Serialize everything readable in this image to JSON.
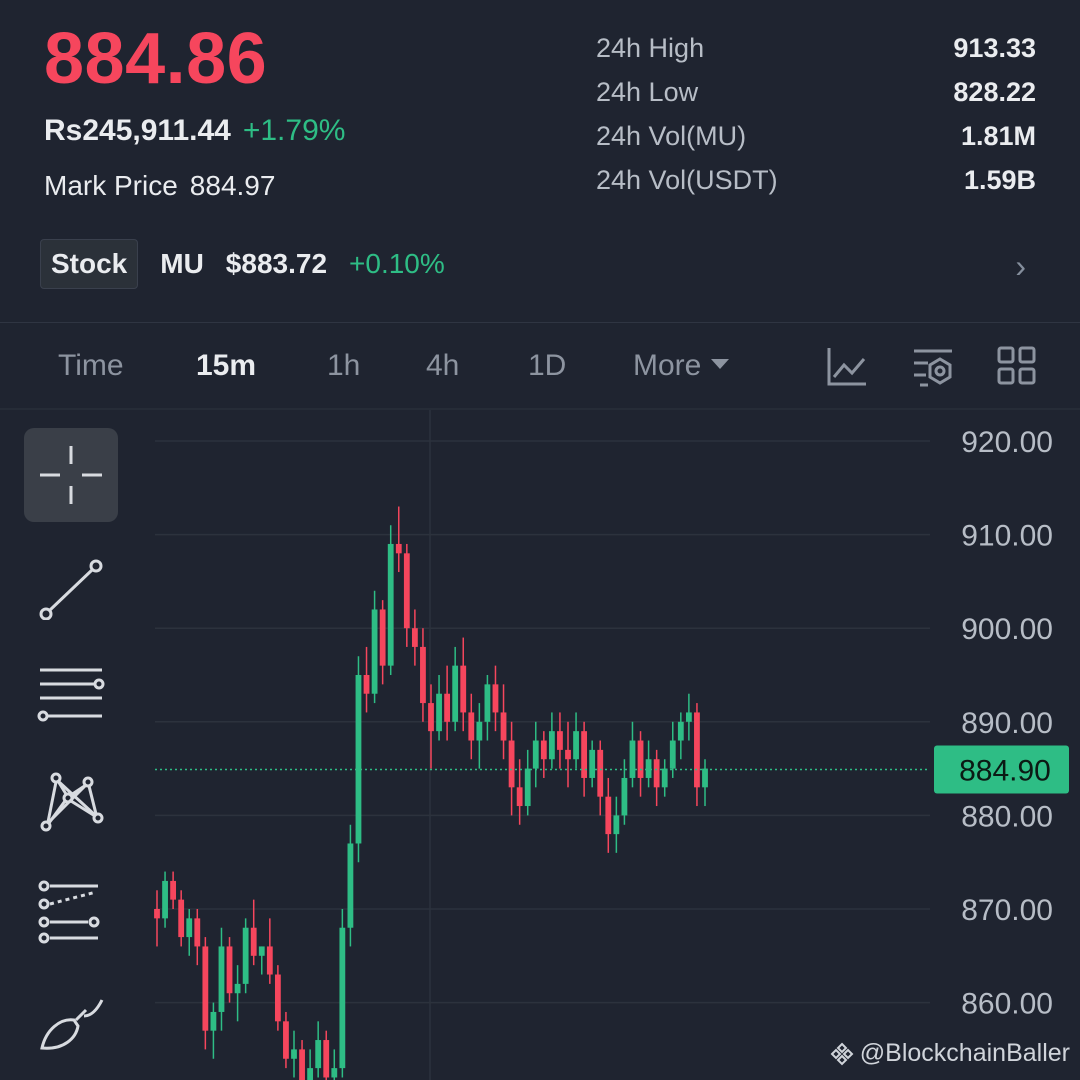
{
  "ticker": {
    "last_price": "884.86",
    "fiat_price": "Rs245,911.44",
    "change_percent": "+1.79%",
    "mark_price_label": "Mark Price",
    "mark_price": "884.97"
  },
  "stats": [
    {
      "label": "24h High",
      "value": "913.33"
    },
    {
      "label": "24h Low",
      "value": "828.22"
    },
    {
      "label": "24h Vol(MU)",
      "value": "1.81M"
    },
    {
      "label": "24h Vol(USDT)",
      "value": "1.59B"
    }
  ],
  "stock": {
    "badge": "Stock",
    "symbol": "MU",
    "price": "$883.72",
    "change": "+0.10%",
    "arrow": "›"
  },
  "timeframes": {
    "time": "Time",
    "m15": "15m",
    "h1": "1h",
    "h4": "4h",
    "d1": "1D",
    "more": "More",
    "active": "15m"
  },
  "toolbar_icons": [
    "indicator-icon",
    "settings-icon",
    "layout-grid-icon"
  ],
  "drawing_tools": [
    "crosshair-icon",
    "trend-line-icon",
    "horizontal-lines-icon",
    "pattern-icon",
    "fib-icon",
    "brush-icon"
  ],
  "colors": {
    "up": "#2ebd85",
    "down": "#f6465d",
    "bg": "#1f2430",
    "grid": "#2c323d",
    "axis_text": "#b7bdc6"
  },
  "watermark": "@BlockchainBaller",
  "chart_data": {
    "type": "candlestick",
    "x_unit": "15m",
    "y_ticks": [
      920,
      910,
      900,
      890,
      880,
      870,
      860
    ],
    "y_tick_labels": [
      "920.00",
      "910.00",
      "900.00",
      "890.00",
      "880.00",
      "870.00",
      "860.00"
    ],
    "ylim": [
      852,
      922
    ],
    "current_price": 884.9,
    "current_price_label": "884.90",
    "grid": true,
    "candles": [
      [
        870,
        872,
        866,
        869
      ],
      [
        869,
        874,
        868,
        873
      ],
      [
        873,
        874,
        870,
        871
      ],
      [
        871,
        872,
        866,
        867
      ],
      [
        867,
        870,
        865,
        869
      ],
      [
        869,
        870,
        864,
        866
      ],
      [
        866,
        867,
        855,
        857
      ],
      [
        857,
        860,
        854,
        859
      ],
      [
        859,
        868,
        857,
        866
      ],
      [
        866,
        867,
        860,
        861
      ],
      [
        861,
        864,
        858,
        862
      ],
      [
        862,
        869,
        861,
        868
      ],
      [
        868,
        871,
        864,
        865
      ],
      [
        865,
        866,
        863,
        866
      ],
      [
        866,
        869,
        862,
        863
      ],
      [
        863,
        864,
        857,
        858
      ],
      [
        858,
        859,
        853,
        854
      ],
      [
        854,
        857,
        852,
        855
      ],
      [
        855,
        856,
        850,
        851
      ],
      [
        851,
        855,
        849,
        853
      ],
      [
        853,
        858,
        852,
        856
      ],
      [
        856,
        857,
        850,
        852
      ],
      [
        852,
        855,
        849,
        853
      ],
      [
        853,
        870,
        852,
        868
      ],
      [
        868,
        879,
        866,
        877
      ],
      [
        877,
        897,
        875,
        895
      ],
      [
        895,
        898,
        891,
        893
      ],
      [
        893,
        904,
        892,
        902
      ],
      [
        902,
        903,
        894,
        896
      ],
      [
        896,
        911,
        895,
        909
      ],
      [
        909,
        913,
        906,
        908
      ],
      [
        908,
        909,
        898,
        900
      ],
      [
        900,
        902,
        896,
        898
      ],
      [
        898,
        900,
        890,
        892
      ],
      [
        892,
        894,
        885,
        889
      ],
      [
        889,
        895,
        888,
        893
      ],
      [
        893,
        896,
        888,
        890
      ],
      [
        890,
        898,
        889,
        896
      ],
      [
        896,
        899,
        889,
        891
      ],
      [
        891,
        893,
        886,
        888
      ],
      [
        888,
        892,
        885,
        890
      ],
      [
        890,
        895,
        888,
        894
      ],
      [
        894,
        896,
        889,
        891
      ],
      [
        891,
        894,
        886,
        888
      ],
      [
        888,
        890,
        880,
        883
      ],
      [
        883,
        886,
        879,
        881
      ],
      [
        881,
        887,
        880,
        885
      ],
      [
        885,
        890,
        883,
        888
      ],
      [
        888,
        889,
        884,
        886
      ],
      [
        886,
        891,
        885,
        889
      ],
      [
        889,
        891,
        885,
        887
      ],
      [
        887,
        890,
        883,
        886
      ],
      [
        886,
        891,
        885,
        889
      ],
      [
        889,
        890,
        882,
        884
      ],
      [
        884,
        888,
        883,
        887
      ],
      [
        887,
        888,
        880,
        882
      ],
      [
        882,
        884,
        876,
        878
      ],
      [
        878,
        882,
        876,
        880
      ],
      [
        880,
        886,
        879,
        884
      ],
      [
        884,
        890,
        883,
        888
      ],
      [
        888,
        889,
        882,
        884
      ],
      [
        884,
        888,
        883,
        886
      ],
      [
        886,
        887,
        881,
        883
      ],
      [
        883,
        886,
        882,
        885
      ],
      [
        885,
        890,
        884,
        888
      ],
      [
        888,
        891,
        886,
        890
      ],
      [
        890,
        893,
        888,
        891
      ],
      [
        891,
        892,
        881,
        883
      ],
      [
        883,
        886,
        881,
        885
      ]
    ]
  }
}
